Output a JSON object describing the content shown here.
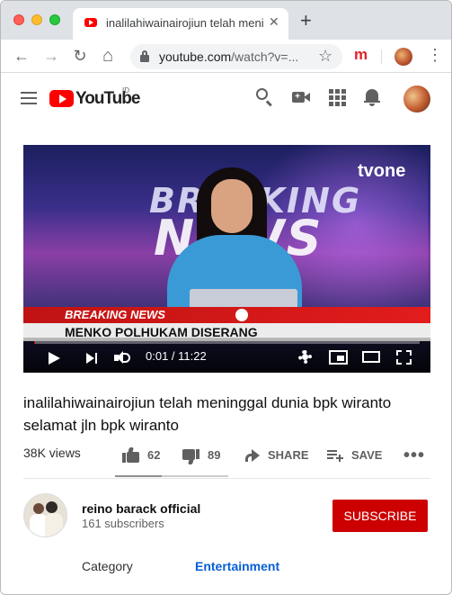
{
  "browser": {
    "tab_title": "inalilahiwainairojiun telah meninggal dunia bpk wiranto selamat jln bpk wiranto - YouTube",
    "tab_close": "✕",
    "new_tab": "+",
    "url_host": "youtube.com",
    "url_path": "/watch?v=...",
    "nav": {
      "back": "←",
      "forward": "→",
      "reload": "↻",
      "home": "⌂"
    },
    "bookmark_star": "☆",
    "extension_label": "m",
    "menu": "⋮"
  },
  "youtube_header": {
    "logo_text": "YouTube",
    "country_code": "ID"
  },
  "player": {
    "channel_logo": "tvone",
    "bg_title_line1": "BREAKING",
    "bg_title_line2": "NEWS",
    "ticker_label": "BREAKING NEWS",
    "ticker_headline": "MENKO POLHUKAM DISERANG",
    "current_time": "0:01",
    "duration": "11:22",
    "time_display": "0:01 / 11:22",
    "progress_fraction": 0.0015
  },
  "video": {
    "title": "inalilahiwainairojiun telah meninggal dunia bpk wiranto selamat jln bpk wiranto",
    "views": "38K views",
    "likes": "62",
    "dislikes": "89",
    "like_fraction": 0.41,
    "share_label": "SHARE",
    "save_label": "SAVE",
    "more_label": "•••"
  },
  "channel": {
    "name": "reino barack official",
    "subscribers": "161 subscribers",
    "subscribe_label": "SUBSCRIBE"
  },
  "metadata": {
    "category_label": "Category",
    "category_value": "Entertainment"
  },
  "colors": {
    "brand_red": "#ff0000",
    "subscribe_red": "#cc0000",
    "link_blue": "#065fd4"
  }
}
